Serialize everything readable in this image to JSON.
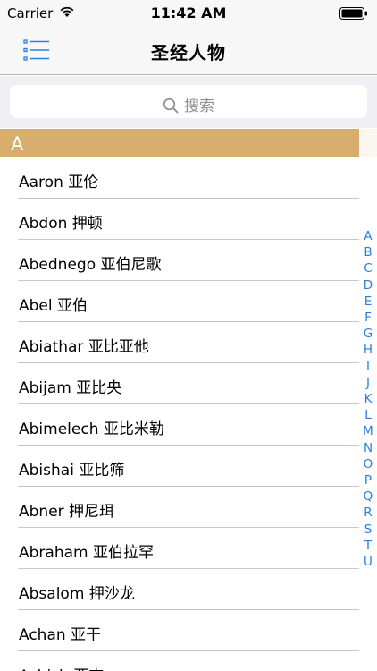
{
  "status_bar": {
    "carrier": "Carrier",
    "time": "11:42 AM",
    "icons": [
      "wifi-icon",
      "battery-icon"
    ]
  },
  "nav": {
    "title": "圣经人物",
    "menu_icon": "list-menu-icon",
    "accent_color": "#2a7de1"
  },
  "search": {
    "placeholder": "搜索",
    "icon": "search-icon"
  },
  "section": {
    "letter": "A",
    "color": "#d7ae6d"
  },
  "items": [
    "Aaron 亚伦",
    "Abdon 押顿",
    "Abednego 亚伯尼歌",
    "Abel 亚伯",
    "Abiathar 亚比亚他",
    "Abijam 亚比央",
    "Abimelech 亚比米勒",
    "Abishai 亚比筛",
    "Abner 押尼珥",
    "Abraham 亚伯拉罕",
    "Absalom 押沙龙",
    "Achan 亚干",
    "Achish 亚吉"
  ],
  "index_letters": [
    "A",
    "B",
    "C",
    "D",
    "E",
    "F",
    "G",
    "H",
    "I",
    "J",
    "K",
    "L",
    "M",
    "N",
    "O",
    "P",
    "Q",
    "R",
    "S",
    "T",
    "U"
  ]
}
